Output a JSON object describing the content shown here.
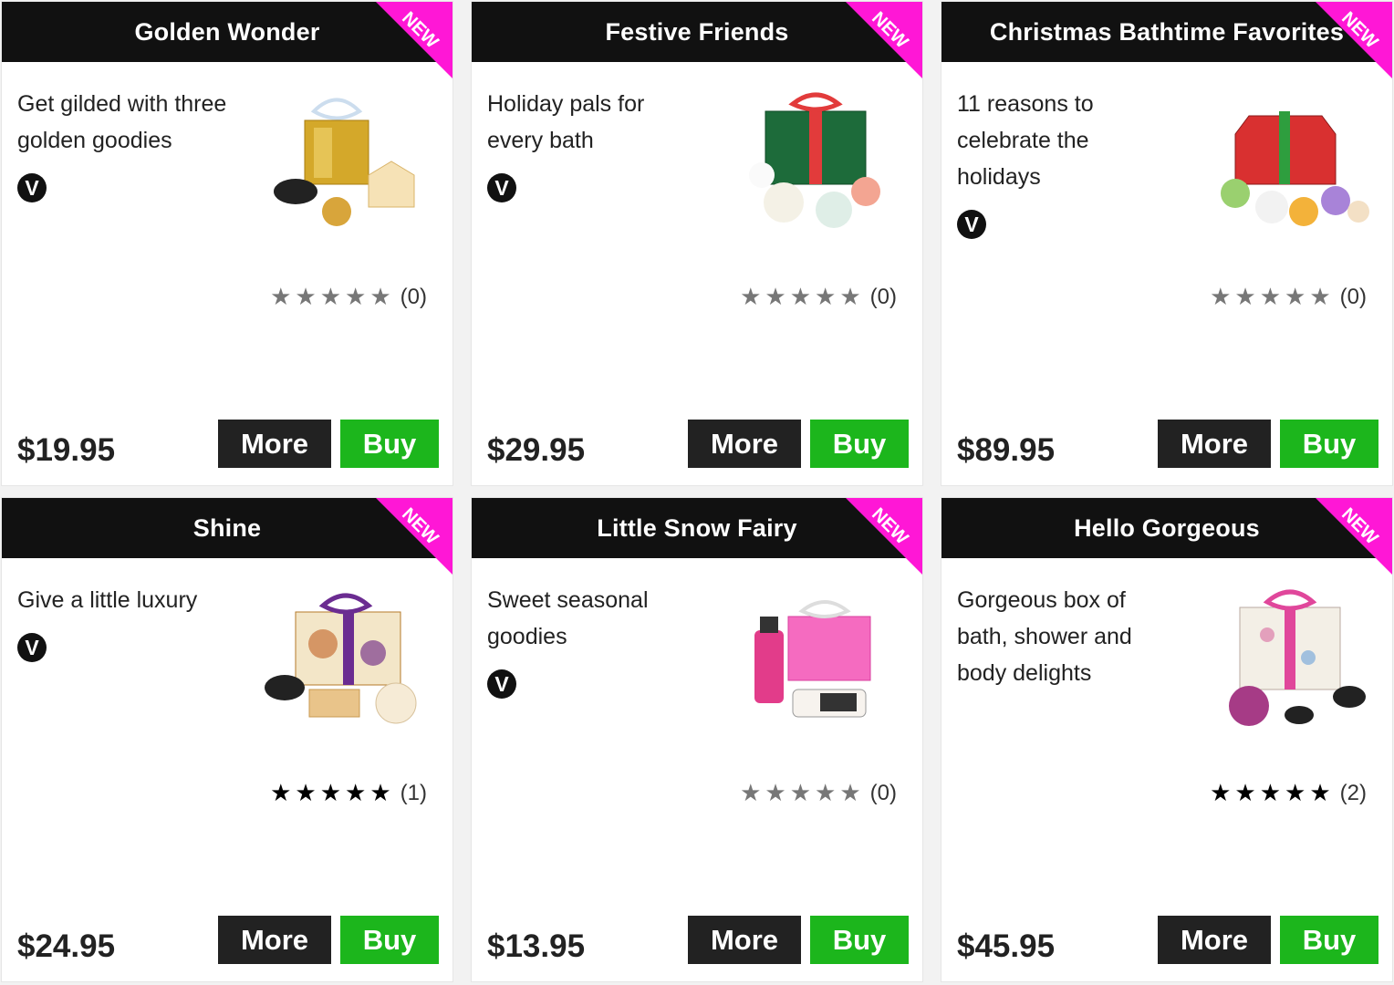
{
  "ribbon_label": "NEW",
  "vegan_symbol": "V",
  "colors": {
    "header": "#111111",
    "ribbon": "#ff17d6",
    "buy": "#1cb61c",
    "more": "#222222"
  },
  "products": [
    {
      "title": "Golden Wonder",
      "description": "Get gilded with three golden goodies",
      "rating_count": "(0)",
      "stars": "★★★★★",
      "stars_filled": 0,
      "price": "$19.95",
      "more_label": "More",
      "buy_label": "Buy"
    },
    {
      "title": "Festive Friends",
      "description": "Holiday pals for every bath",
      "rating_count": "(0)",
      "stars": "★★★★★",
      "stars_filled": 0,
      "price": "$29.95",
      "more_label": "More",
      "buy_label": "Buy"
    },
    {
      "title": "Christmas Bathtime Favorites",
      "description": "11 reasons to celebrate the holidays",
      "rating_count": "(0)",
      "stars": "★★★★★",
      "stars_filled": 0,
      "price": "$89.95",
      "more_label": "More",
      "buy_label": "Buy"
    },
    {
      "title": "Shine",
      "description": "Give a little luxury",
      "rating_count": "(1)",
      "stars": "★★★★★",
      "stars_filled": 5,
      "price": "$24.95",
      "more_label": "More",
      "buy_label": "Buy"
    },
    {
      "title": "Little Snow Fairy",
      "description": "Sweet seasonal goodies",
      "rating_count": "(0)",
      "stars": "★★★★★",
      "stars_filled": 0,
      "price": "$13.95",
      "more_label": "More",
      "buy_label": "Buy"
    },
    {
      "title": "Hello Gorgeous",
      "description": "Gorgeous box of bath, shower and body delights",
      "rating_count": "(2)",
      "stars": "★★★★★",
      "stars_filled": 5,
      "price": "$45.95",
      "more_label": "More",
      "buy_label": "Buy"
    }
  ]
}
